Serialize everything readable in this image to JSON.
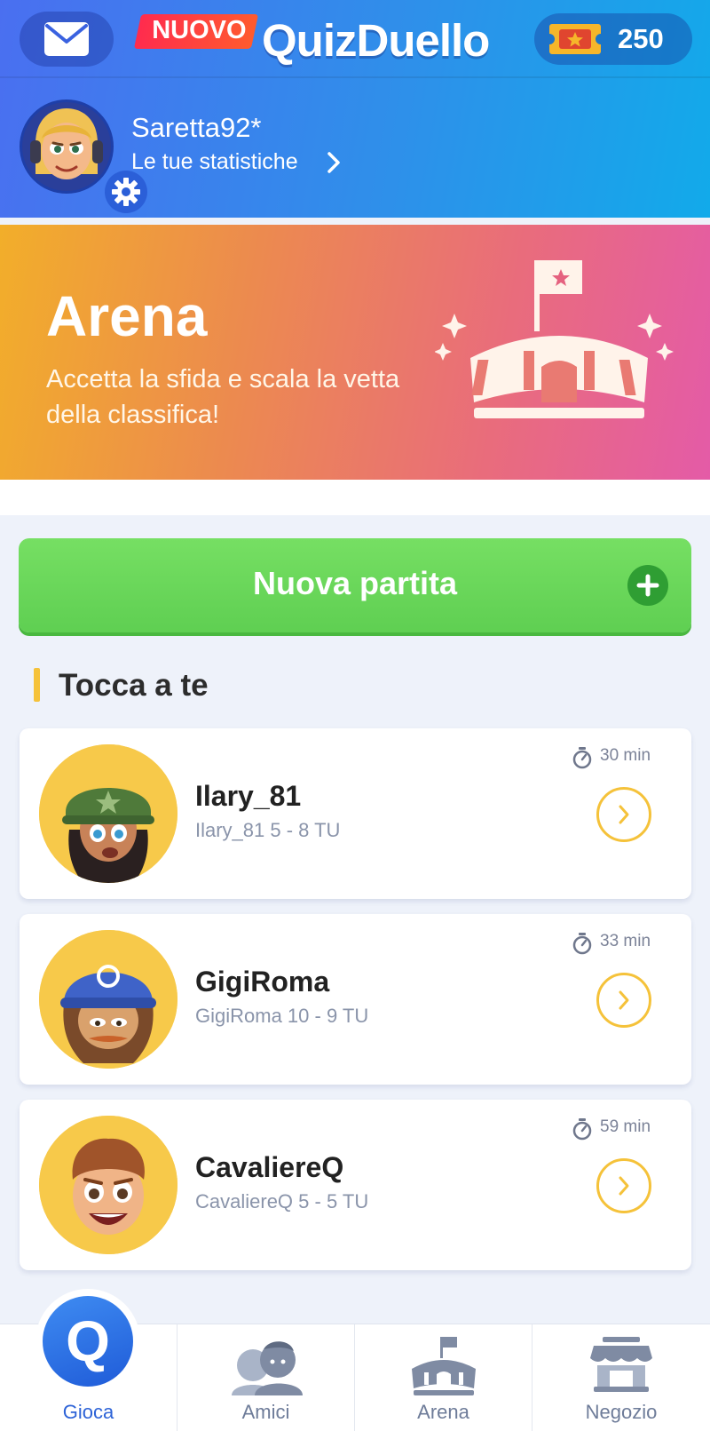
{
  "header": {
    "badge": "NUOVO",
    "app_name": "QuizDuello",
    "coins": "250"
  },
  "profile": {
    "username": "Saretta92*",
    "stats_link": "Le tue statistiche"
  },
  "arena_banner": {
    "title": "Arena",
    "subtitle": "Accetta la sfida e scala la vetta della classifica!"
  },
  "new_game": {
    "label": "Nuova partita"
  },
  "section": {
    "title": "Tocca a te"
  },
  "games": [
    {
      "opponent": "Ilary_81",
      "score": "Ilary_81 5 - 8 TU",
      "time": "30 min"
    },
    {
      "opponent": "GigiRoma",
      "score": "GigiRoma 10 - 9 TU",
      "time": "33 min"
    },
    {
      "opponent": "CavaliereQ",
      "score": "CavaliereQ 5 - 5 TU",
      "time": "59 min"
    }
  ],
  "bottom_nav": {
    "play": "Gioca",
    "friends": "Amici",
    "arena": "Arena",
    "shop": "Negozio",
    "play_glyph": "Q"
  },
  "colors": {
    "header_blue": "#2f8fea",
    "accent_yellow": "#f5c23a",
    "play_green": "#5fcf52",
    "active_nav": "#2d63d7"
  },
  "icons": [
    "mail-icon",
    "ticket-icon",
    "gear-icon",
    "chevron-right-icon",
    "stadium-icon",
    "plus-icon",
    "timer-icon",
    "friends-icon",
    "shop-icon"
  ]
}
